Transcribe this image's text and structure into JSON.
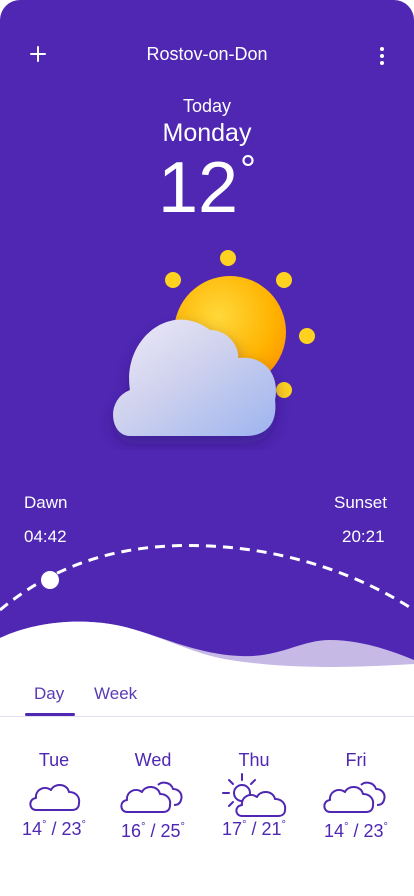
{
  "header": {
    "city": "Rostov-on-Don",
    "add_icon": "plus-icon",
    "menu_icon": "more-vertical-icon"
  },
  "current": {
    "label": "Today",
    "day": "Monday",
    "temperature": "12",
    "degree_symbol": "°",
    "condition_icon": "partly-cloudy-icon"
  },
  "sun": {
    "dawn_label": "Dawn",
    "dawn_time": "04:42",
    "sunset_label": "Sunset",
    "sunset_time": "20:21"
  },
  "tabs": [
    {
      "label": "Day",
      "active": true
    },
    {
      "label": "Week",
      "active": false
    }
  ],
  "forecast": [
    {
      "day": "Tue",
      "low": "14",
      "high": "23",
      "icon": "cloud-icon"
    },
    {
      "day": "Wed",
      "low": "16",
      "high": "25",
      "icon": "clouds-icon"
    },
    {
      "day": "Thu",
      "low": "17",
      "high": "21",
      "icon": "sun-cloud-icon"
    },
    {
      "day": "Fri",
      "low": "14",
      "high": "23",
      "icon": "clouds-icon"
    }
  ],
  "colors": {
    "primary": "#4f27b3",
    "accent_sun": "#ffc400",
    "wave_light": "#c6b9e6"
  }
}
